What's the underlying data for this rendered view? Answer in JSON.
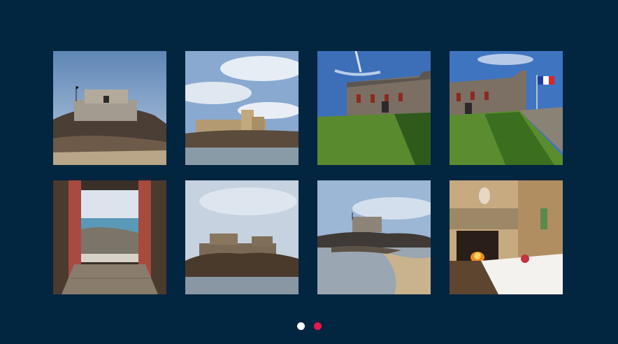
{
  "gallery": {
    "images": [
      {
        "name": "fort-on-rocks-low-tide"
      },
      {
        "name": "fort-across-water"
      },
      {
        "name": "barracks-building-lawn"
      },
      {
        "name": "barracks-with-french-flag"
      },
      {
        "name": "doorway-view-to-sea"
      },
      {
        "name": "fort-on-island-distance"
      },
      {
        "name": "fort-beach-low-tide"
      },
      {
        "name": "dining-room-fireplace"
      }
    ]
  },
  "pagination": {
    "pages": 2,
    "current": 2,
    "colors": {
      "inactive": "#ffffff",
      "active": "#e8174e"
    }
  },
  "colors": {
    "background": "#022540"
  }
}
